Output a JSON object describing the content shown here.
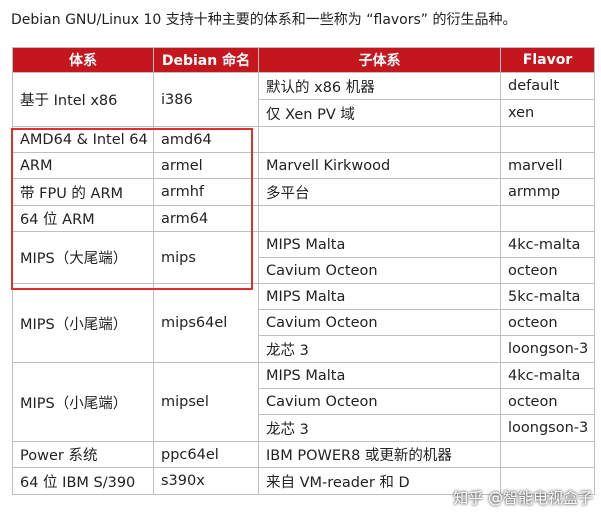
{
  "intro": "Debian GNU/Linux 10 支持十种主要的体系和一些称为 “flavors” 的衍生品种。",
  "headers": [
    "体系",
    "Debian 命名",
    "子体系",
    "Flavor"
  ],
  "rows": [
    {
      "arch": "基于 Intel x86",
      "name": "i386",
      "sub": "默认的 x86 机器",
      "flavor": "default"
    },
    {
      "arch": "",
      "name": "",
      "sub": "仅 Xen PV 域",
      "flavor": "xen"
    },
    {
      "arch": "AMD64 & Intel 64",
      "name": "amd64",
      "sub": "",
      "flavor": ""
    },
    {
      "arch": "ARM",
      "name": "armel",
      "sub": "Marvell Kirkwood",
      "flavor": "marvell"
    },
    {
      "arch": "带 FPU 的 ARM",
      "name": "armhf",
      "sub": "多平台",
      "flavor": "armmp"
    },
    {
      "arch": "64 位 ARM",
      "name": "arm64",
      "sub": "",
      "flavor": ""
    },
    {
      "arch": "MIPS（大尾端）",
      "name": "mips",
      "sub": "MIPS Malta",
      "flavor": "4kc-malta"
    },
    {
      "arch": "",
      "name": "",
      "sub": "Cavium Octeon",
      "flavor": "octeon"
    },
    {
      "arch": "MIPS（小尾端）",
      "name": "mips64el",
      "sub": "MIPS Malta",
      "flavor": "5kc-malta"
    },
    {
      "arch": "",
      "name": "",
      "sub": "Cavium Octeon",
      "flavor": "octeon"
    },
    {
      "arch": "",
      "name": "",
      "sub": "龙芯 3",
      "flavor": "loongson-3"
    },
    {
      "arch": "MIPS（小尾端）",
      "name": "mipsel",
      "sub": "MIPS Malta",
      "flavor": "4kc-malta"
    },
    {
      "arch": "",
      "name": "",
      "sub": "Cavium Octeon",
      "flavor": "octeon"
    },
    {
      "arch": "",
      "name": "",
      "sub": "龙芯 3",
      "flavor": "loongson-3"
    },
    {
      "arch": "Power 系统",
      "name": "ppc64el",
      "sub": "IBM POWER8 或更新的机器",
      "flavor": ""
    },
    {
      "arch": "64 位 IBM S/390",
      "name": "s390x",
      "sub": "来自 VM-reader 和 D",
      "flavor": ""
    }
  ],
  "watermark": "知乎 @智能电视盒子",
  "colors": {
    "header_bg": "#c4161c",
    "highlight": "#e0302c",
    "grid": "#bfbfbf"
  }
}
